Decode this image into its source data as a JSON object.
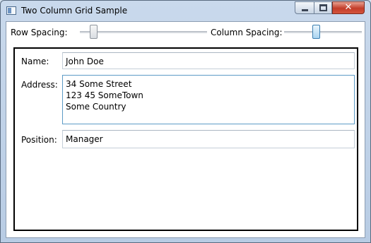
{
  "window": {
    "title": "Two Column Grid Sample",
    "close_glyph": "✕"
  },
  "controls": {
    "row_spacing_label": "Row Spacing:",
    "row_spacing_value": 0,
    "column_spacing_label": "Column Spacing:",
    "column_spacing_value": 0.3
  },
  "form": {
    "name_label": "Name:",
    "name_value": "John Doe",
    "address_label": "Address:",
    "address_value": "34 Some Street\n123 45 SomeTown\nSome Country",
    "position_label": "Position:",
    "position_value": "Manager"
  },
  "colors": {
    "accent": "#3c7fb1",
    "window_frame": "#b8cce4",
    "close_button": "#c33d2a"
  },
  "icons": {
    "app": "window-icon",
    "minimize": "minimize-icon",
    "maximize": "maximize-icon",
    "close": "close-icon"
  }
}
